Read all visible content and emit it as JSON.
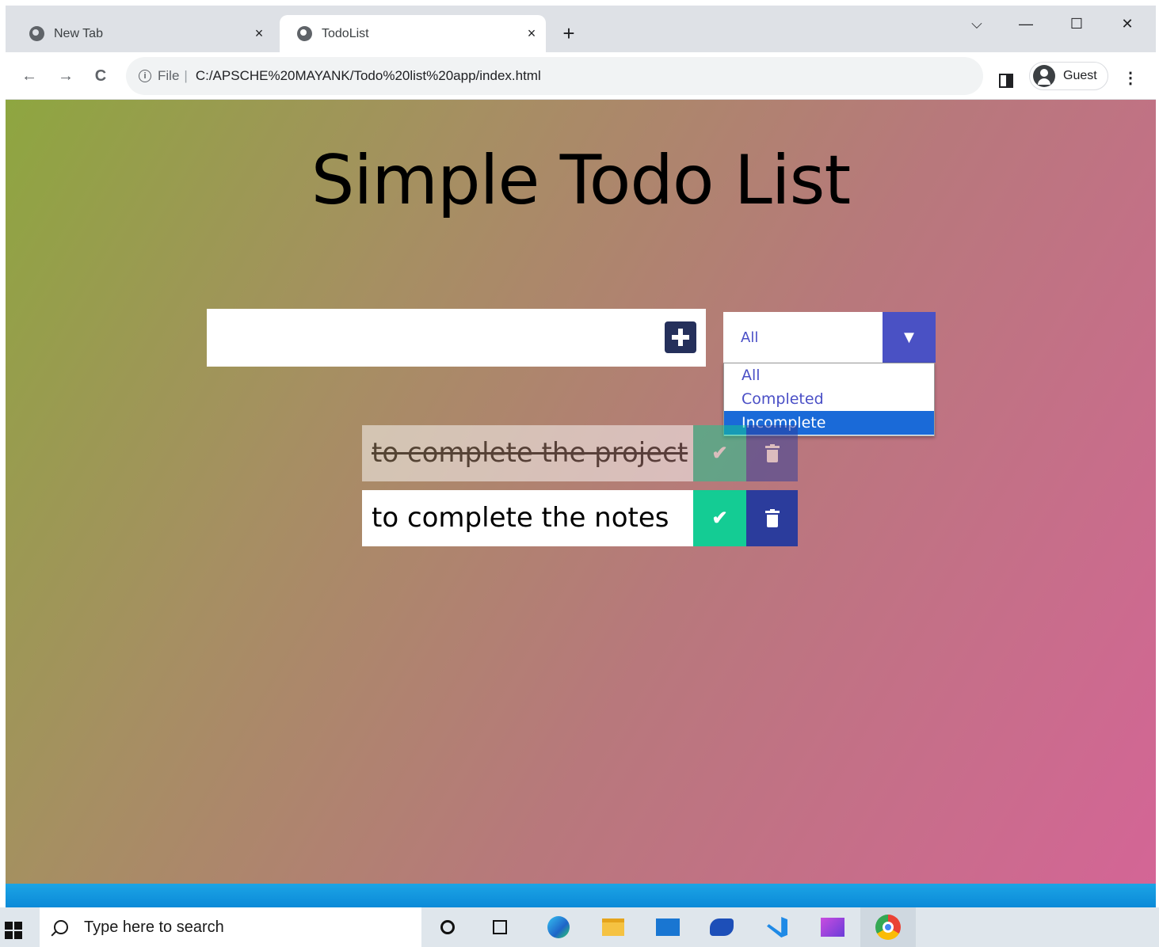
{
  "browser": {
    "tabs": [
      {
        "title": "New Tab",
        "active": false
      },
      {
        "title": "TodoList",
        "active": true
      }
    ],
    "close_glyph": "×",
    "new_tab_glyph": "+",
    "window_controls": {
      "tab_search": "⌵",
      "minimize": "—",
      "maximize": "☐",
      "close": "✕"
    },
    "nav": {
      "back": "←",
      "forward": "→",
      "reload": "C"
    },
    "address": {
      "scheme": "File",
      "separator": "|",
      "url": "C:/APSCHE%20MAYANK/Todo%20list%20app/index.html",
      "info_glyph": "i"
    },
    "profile": {
      "label": "Guest"
    },
    "menu_glyph": "⋮"
  },
  "app": {
    "title": "Simple Todo List",
    "input": {
      "value": "",
      "placeholder": ""
    },
    "filter": {
      "selected": "All",
      "arrow_glyph": "▼",
      "options": [
        "All",
        "Completed",
        "Incomplete"
      ],
      "highlighted": "Incomplete"
    },
    "todos": [
      {
        "text": "to complete the project",
        "completed": true
      },
      {
        "text": "to complete the notes",
        "completed": false
      }
    ],
    "check_glyph": "✔",
    "colors": {
      "add_button": "#25305b",
      "filter_arrow": "#4a51c4",
      "check": "#14cc94",
      "trash": "#2b3c9c",
      "highlight": "#1a6ad8"
    }
  },
  "taskbar": {
    "search_placeholder": "Type here to search",
    "apps": [
      "cortana-icon",
      "task-view-icon",
      "edge-icon",
      "file-explorer-icon",
      "mail-icon",
      "paint-icon",
      "vscode-icon",
      "clip-icon",
      "chrome-icon"
    ]
  }
}
